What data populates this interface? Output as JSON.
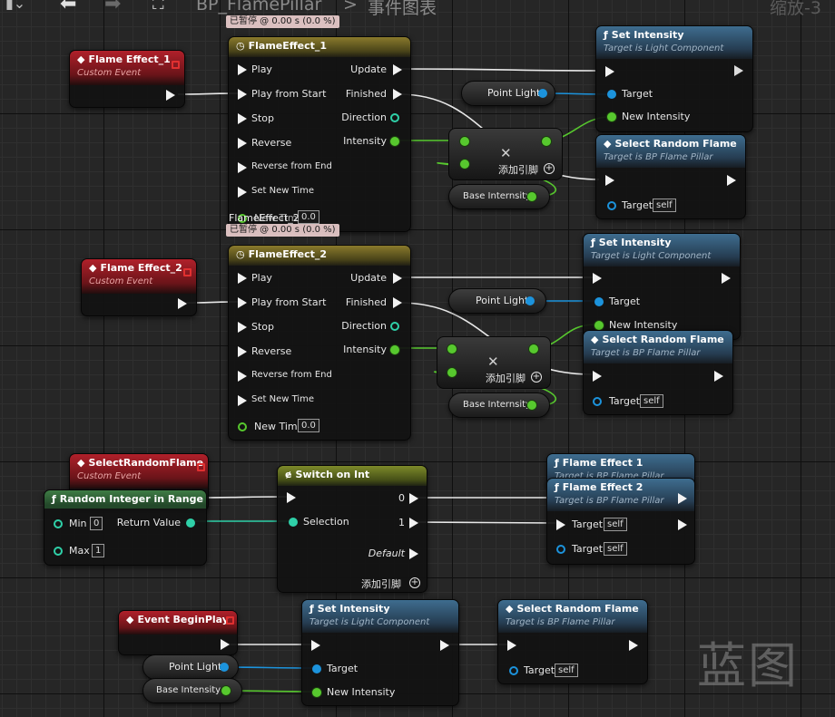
{
  "toolbar": {
    "breadcrumb_blueprint": "BP_FlamePillar",
    "breadcrumb_sep": ">",
    "breadcrumb_graph": "事件图表",
    "zoom_label": "缩放-3"
  },
  "debug": {
    "paused_top": "已暂停 @ 0.00 s (0.0 %)",
    "paused_mid": "已暂停 @ 0.00 s (0.0 %)",
    "overlap_title": "FlameEffect_2"
  },
  "pins": {
    "play": "Play",
    "play_from_start": "Play from Start",
    "stop": "Stop",
    "reverse": "Reverse",
    "reverse_from_end": "Reverse from End",
    "set_new_time": "Set New Time",
    "new_time": "New Time",
    "update": "Update",
    "finished": "Finished",
    "direction": "Direction",
    "intensity": "Intensity",
    "target": "Target",
    "new_intensity": "New Intensity",
    "add_pin": "添加引脚",
    "self": "self",
    "min": "Min",
    "max": "Max",
    "return_value": "Return Value",
    "selection": "Selection",
    "default": "Default",
    "zero": "0",
    "one": "1"
  },
  "events": {
    "flame1": {
      "title": "Flame Effect_1",
      "sub": "Custom Event"
    },
    "flame2": {
      "title": "Flame Effect_2",
      "sub": "Custom Event"
    },
    "select": {
      "title": "SelectRandomFlame",
      "sub": "Custom Event"
    },
    "begin": {
      "title": "Event BeginPlay"
    }
  },
  "timelines": {
    "t1": {
      "title": "FlameEffect_1",
      "new_time_value": "0.0"
    },
    "t2": {
      "title": "FlameEffect_2",
      "new_time_value": "0.0"
    }
  },
  "functions": {
    "set_intensity": {
      "title": "Set Intensity",
      "sub": "Target is Light Component"
    },
    "select_random": {
      "title": "Select Random Flame",
      "sub": "Target is BP Flame Pillar"
    },
    "flame_effect1": {
      "title": "Flame Effect 1",
      "sub": "Target is BP Flame Pillar"
    },
    "flame_effect2": {
      "title": "Flame Effect 2",
      "sub": "Target is BP Flame Pillar"
    },
    "random_int": {
      "title": "Random Integer in Range",
      "min_value": "0",
      "max_value": "1"
    },
    "switch_int": {
      "title": "Switch on Int"
    }
  },
  "getters": {
    "point_light": "Point Light",
    "base_intensity": "Base Internsity",
    "base_intensity_bottom": "Base Intensity"
  },
  "watermark": "蓝图",
  "colors": {
    "exec": "#f2f2f2",
    "float": "#57c82e",
    "object": "#1c93dc",
    "int": "#2fd0a8",
    "event_header": "#b0202a",
    "function_header": "#3e6d8f",
    "timeline_header": "#8a7a2c"
  }
}
